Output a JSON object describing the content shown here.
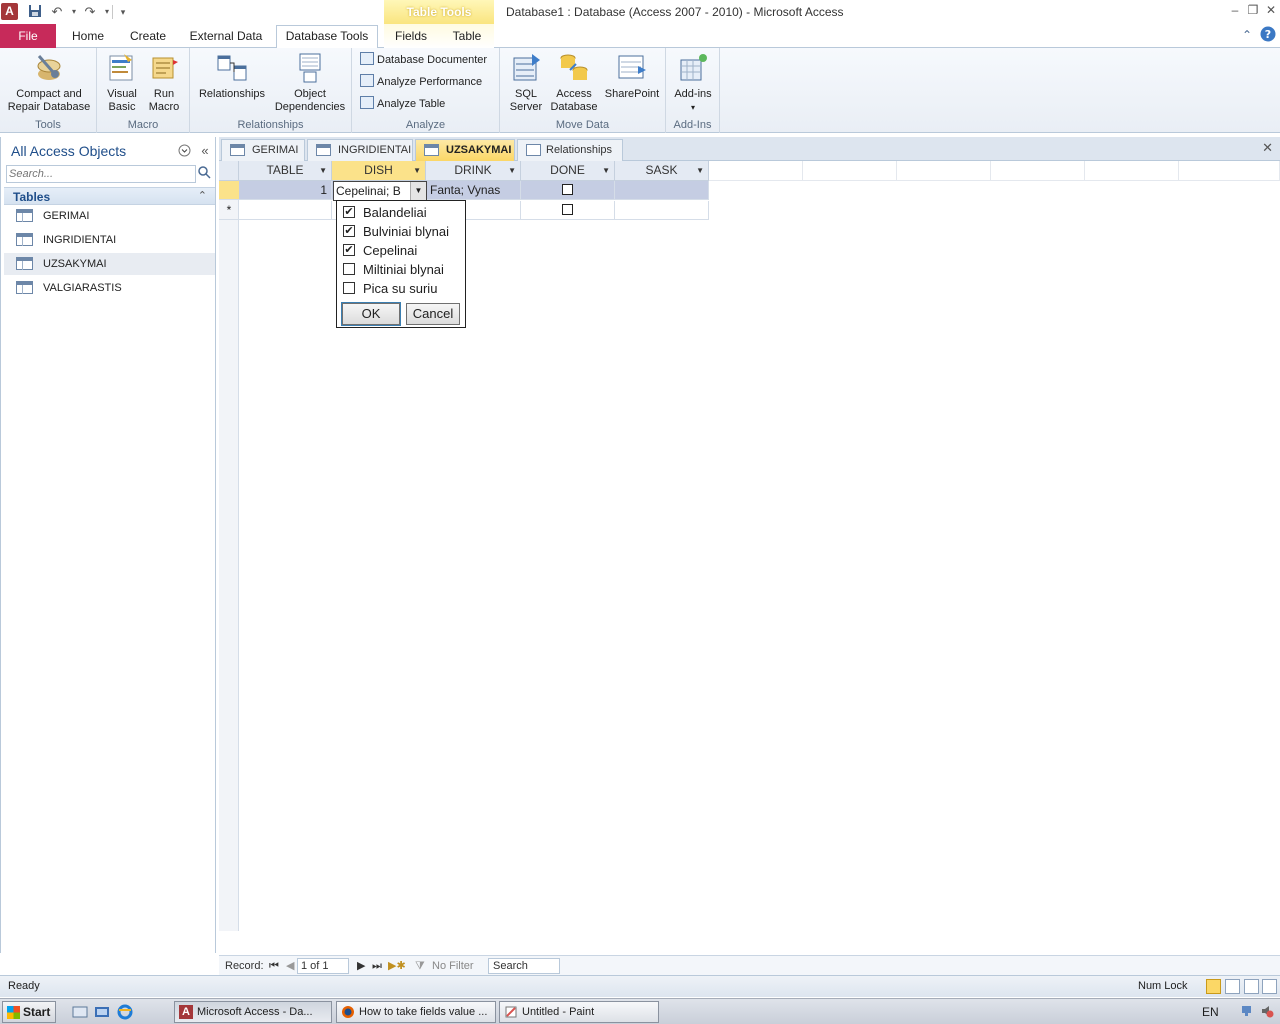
{
  "title_bar": {
    "app_icon_letter": "A",
    "window_title": "Database1 : Database (Access 2007 - 2010)  -  Microsoft Access",
    "context_group": "Table Tools"
  },
  "ribbon_tabs": {
    "file": "File",
    "home": "Home",
    "create": "Create",
    "external_data": "External Data",
    "database_tools": "Database Tools",
    "fields": "Fields",
    "table": "Table"
  },
  "ribbon": {
    "tools": {
      "label": "Tools",
      "compact_line1": "Compact and",
      "compact_line2": "Repair Database"
    },
    "macro": {
      "label": "Macro",
      "vb_line1": "Visual",
      "vb_line2": "Basic",
      "run_line1": "Run",
      "run_line2": "Macro"
    },
    "relationships": {
      "label": "Relationships",
      "relationships_btn": "Relationships",
      "objdep_line1": "Object",
      "objdep_line2": "Dependencies"
    },
    "analyze": {
      "label": "Analyze",
      "documenter": "Database Documenter",
      "performance": "Analyze Performance",
      "table": "Analyze Table"
    },
    "move_data": {
      "label": "Move Data",
      "sql_line1": "SQL",
      "sql_line2": "Server",
      "access_line1": "Access",
      "access_line2": "Database",
      "sharepoint": "SharePoint"
    },
    "addins": {
      "label": "Add-Ins",
      "btn": "Add-ins"
    }
  },
  "nav_pane": {
    "title": "All Access Objects",
    "search_placeholder": "Search...",
    "section": "Tables",
    "items": [
      "GERIMAI",
      "INGRIDIENTAI",
      "UZSAKYMAI",
      "VALGIARASTIS"
    ],
    "selected": "UZSAKYMAI"
  },
  "doc_tabs": [
    "GERIMAI",
    "INGRIDIENTAI",
    "UZSAKYMAI",
    "Relationships"
  ],
  "doc_tab_active": "UZSAKYMAI",
  "datasheet": {
    "columns": [
      "TABLE",
      "DISH",
      "DRINK",
      "DONE",
      "SASK"
    ],
    "selected_column": "DISH",
    "rows": [
      {
        "table": "1",
        "dish": "Cepelinai; B",
        "drink": "Fanta; Vynas",
        "done": false,
        "sask": ""
      }
    ],
    "new_row_marker": "*"
  },
  "dish_dropdown": {
    "options": [
      {
        "label": "Balandeliai",
        "checked": true
      },
      {
        "label": "Bulviniai blynai",
        "checked": true
      },
      {
        "label": "Cepelinai",
        "checked": true
      },
      {
        "label": "Miltiniai blynai",
        "checked": false
      },
      {
        "label": "Pica su suriu",
        "checked": false
      }
    ],
    "ok": "OK",
    "cancel": "Cancel"
  },
  "record_nav": {
    "label": "Record:",
    "position": "1 of 1",
    "filter": "No Filter",
    "search": "Search"
  },
  "status_bar": {
    "status": "Ready",
    "num_lock": "Num Lock"
  },
  "taskbar": {
    "start": "Start",
    "tasks": [
      "Microsoft Access - Da...",
      "How to take fields value ...",
      "Untitled - Paint"
    ],
    "lang": "EN"
  },
  "colors": {
    "file_tab": "#c72a5a",
    "selected_header": "#fbe28a",
    "selected_row": "#c5cde3",
    "context_tab": "#f9e37a"
  }
}
